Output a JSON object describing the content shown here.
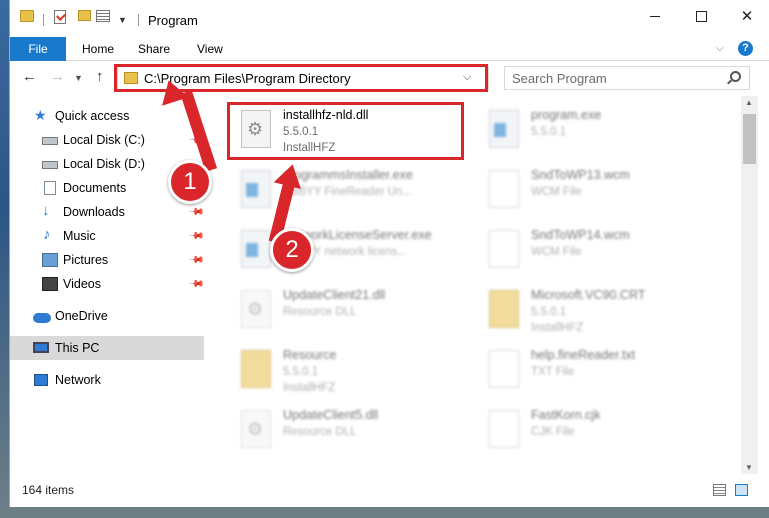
{
  "window": {
    "title": "Program"
  },
  "ribbon": {
    "tabs": [
      "File",
      "Home",
      "Share",
      "View"
    ],
    "help": "?"
  },
  "address": {
    "path": "C:\\Program Files\\Program Directory",
    "search_placeholder": "Search Program"
  },
  "sidebar": {
    "items": [
      {
        "label": "Quick access",
        "icon": "star-icon"
      },
      {
        "label": "Local Disk (C:)",
        "icon": "disk-icon"
      },
      {
        "label": "Local Disk (D:)",
        "icon": "disk-icon"
      },
      {
        "label": "Documents",
        "icon": "documents-icon"
      },
      {
        "label": "Downloads",
        "icon": "download-icon"
      },
      {
        "label": "Music",
        "icon": "music-icon"
      },
      {
        "label": "Pictures",
        "icon": "pictures-icon"
      },
      {
        "label": "Videos",
        "icon": "videos-icon"
      },
      {
        "label": "OneDrive",
        "icon": "cloud-icon"
      },
      {
        "label": "This PC",
        "icon": "computer-icon"
      },
      {
        "label": "Network",
        "icon": "network-icon"
      }
    ]
  },
  "files": [
    {
      "name": "installhfz-nld.dll",
      "line2": "5.5.0.1",
      "line3": "InstallHFZ",
      "icon": "gear-file-icon"
    },
    {
      "name": "program.exe",
      "line2": "5.5.0.1",
      "line3": "",
      "icon": "exe-icon"
    },
    {
      "name": "programmsInstaller.exe",
      "line2": "ABBYY FineReader Un...",
      "line3": "",
      "icon": "exe-icon"
    },
    {
      "name": "SndToWP13.wcm",
      "line2": "WCM File",
      "line3": "",
      "icon": "document-icon"
    },
    {
      "name": "NetworkLicenseServer.exe",
      "line2": "ABBYY network licens...",
      "line3": "",
      "icon": "exe-icon"
    },
    {
      "name": "SndToWP14.wcm",
      "line2": "WCM File",
      "line3": "",
      "icon": "document-icon"
    },
    {
      "name": "UpdateClient21.dll",
      "line2": "Resource DLL",
      "line3": "",
      "icon": "gear-file-icon"
    },
    {
      "name": "Microsoft.VC90.CRT",
      "line2": "5.5.0.1",
      "line3": "InstallHFZ",
      "icon": "folder-icon"
    },
    {
      "name": "Resource",
      "line2": "5.5.0.1",
      "line3": "InstallHFZ",
      "icon": "folder-icon"
    },
    {
      "name": "help.fineReader.txt",
      "line2": "TXT File",
      "line3": "",
      "icon": "document-icon"
    },
    {
      "name": "UpdateClient5.dll",
      "line2": "Resource DLL",
      "line3": "",
      "icon": "gear-file-icon"
    },
    {
      "name": "FastKorn.cjk",
      "line2": "CJK File",
      "line3": "",
      "icon": "document-icon"
    }
  ],
  "status": {
    "count": "164 items"
  },
  "annotations": {
    "badge1": "1",
    "badge2": "2",
    "accent": "#d9262b"
  }
}
